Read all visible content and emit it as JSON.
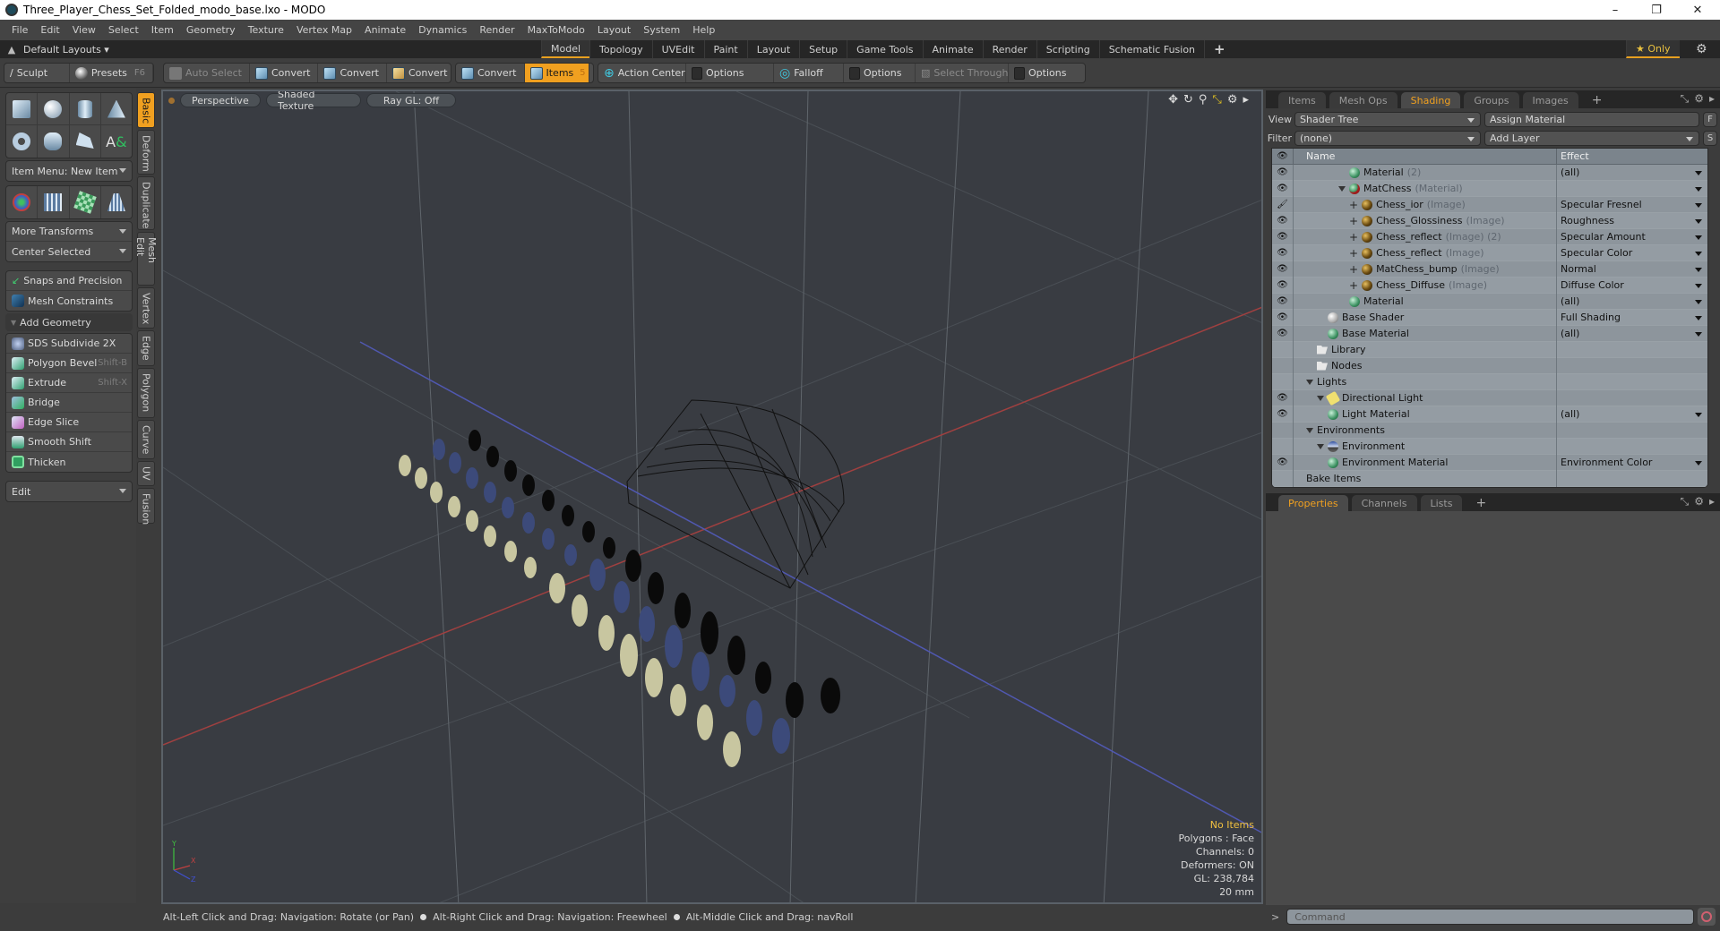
{
  "window": {
    "title": "Three_Player_Chess_Set_Folded_modo_base.lxo - MODO",
    "controls": [
      "minimize-icon",
      "restore-icon",
      "close-icon"
    ]
  },
  "menu": [
    "File",
    "Edit",
    "View",
    "Select",
    "Item",
    "Geometry",
    "Texture",
    "Vertex Map",
    "Animate",
    "Dynamics",
    "Render",
    "MaxToModo",
    "Layout",
    "System",
    "Help"
  ],
  "layoutbar": {
    "layouts_label": "Default Layouts ▾",
    "tabs": [
      "Model",
      "Topology",
      "UVEdit",
      "Paint",
      "Layout",
      "Setup",
      "Game Tools",
      "Animate",
      "Render",
      "Scripting",
      "Schematic Fusion"
    ],
    "active_tab": "Model",
    "add": "+",
    "only_label": "★ Only"
  },
  "toolbar": {
    "sculpt": "Sculpt",
    "presets": "Presets",
    "presets_key": "F6",
    "auto_select": "Auto Select",
    "convert1": "Convert",
    "convert2": "Convert",
    "convert3": "Convert",
    "convert4": "Convert",
    "items": "Items",
    "items_count": "5",
    "action_center": "Action Center",
    "options1": "Options",
    "falloff": "Falloff",
    "options2": "Options",
    "select_through": "Select Through",
    "options3": "Options"
  },
  "leftpanel": {
    "item_menu": "Item Menu: New Item",
    "more_transforms": "More Transforms",
    "center_selected": "Center Selected",
    "snaps": "Snaps and Precision",
    "mesh_constraints": "Mesh Constraints",
    "add_geometry": "Add Geometry",
    "tools": [
      {
        "label": "SDS Subdivide 2X",
        "shortcut": ""
      },
      {
        "label": "Polygon Bevel",
        "shortcut": "Shift-B"
      },
      {
        "label": "Extrude",
        "shortcut": "Shift-X"
      },
      {
        "label": "Bridge",
        "shortcut": ""
      },
      {
        "label": "Edge Slice",
        "shortcut": ""
      },
      {
        "label": "Smooth Shift",
        "shortcut": ""
      },
      {
        "label": "Thicken",
        "shortcut": ""
      }
    ],
    "edit": "Edit",
    "vtabs": [
      "Basic",
      "Deform",
      "Duplicate",
      "Mesh Edit",
      "Vertex",
      "Edge",
      "Polygon",
      "Curve",
      "UV",
      "Fusion"
    ],
    "active_vtab": "Basic"
  },
  "viewport": {
    "view": "Perspective",
    "shading": "Shaded Texture",
    "raygl": "Ray GL: Off",
    "info": {
      "items": "No Items",
      "polygons": "Polygons : Face",
      "channels": "Channels: 0",
      "deformers": "Deformers: ON",
      "gl": "GL: 238,784",
      "unit": "20 mm"
    },
    "axis": {
      "x": "X",
      "y": "Y",
      "z": "Z"
    }
  },
  "statusbar": {
    "hint1": "Alt-Left Click and Drag: Navigation: Rotate (or Pan)",
    "hint2": "Alt-Right Click and Drag: Navigation: Freewheel",
    "hint3": "Alt-Middle Click and Drag: navRoll"
  },
  "shading_panel": {
    "tabs": [
      "Items",
      "Mesh Ops",
      "Shading",
      "Groups",
      "Images"
    ],
    "active_tab": "Shading",
    "view_label": "View",
    "view_value": "Shader Tree",
    "assign_material": "Assign Material",
    "f_btn": "F",
    "filter_label": "Filter",
    "filter_value": "(none)",
    "add_layer": "Add Layer",
    "s_btn": "S",
    "columns": {
      "name": "Name",
      "effect": "Effect"
    },
    "rows": [
      {
        "eye": "eye",
        "indent": 4,
        "toggle": "",
        "icon": "b-green",
        "name": "Material",
        "type": "(2)",
        "effect": "(all)",
        "dd": true
      },
      {
        "eye": "eye",
        "indent": 3,
        "toggle": "tri",
        "icon": "b-red",
        "name": "MatChess",
        "type": "(Material)",
        "effect": "",
        "dd": true
      },
      {
        "eye": "brush",
        "indent": 4,
        "toggle": "plus",
        "icon": "b-img",
        "name": "Chess_ior",
        "type": "(Image)",
        "effect": "Specular Fresnel",
        "dd": true
      },
      {
        "eye": "eye",
        "indent": 4,
        "toggle": "plus",
        "icon": "b-img",
        "name": "Chess_Glossiness",
        "type": "(Image)",
        "effect": "Roughness",
        "dd": true
      },
      {
        "eye": "eye",
        "indent": 4,
        "toggle": "plus",
        "icon": "b-img",
        "name": "Chess_reflect",
        "type": "(Image) (2)",
        "effect": "Specular Amount",
        "dd": true
      },
      {
        "eye": "eye",
        "indent": 4,
        "toggle": "plus",
        "icon": "b-img",
        "name": "Chess_reflect",
        "type": "(Image)",
        "effect": "Specular Color",
        "dd": true
      },
      {
        "eye": "eye",
        "indent": 4,
        "toggle": "plus",
        "icon": "b-img",
        "name": "MatChess_bump",
        "type": "(Image)",
        "effect": "Normal",
        "dd": true
      },
      {
        "eye": "eye",
        "indent": 4,
        "toggle": "plus",
        "icon": "b-img",
        "name": "Chess_Diffuse",
        "type": "(Image)",
        "effect": "Diffuse Color",
        "dd": true
      },
      {
        "eye": "eye",
        "indent": 4,
        "toggle": "",
        "icon": "b-green",
        "name": "Material",
        "type": "",
        "effect": "(all)",
        "dd": true
      },
      {
        "eye": "eye",
        "indent": 2,
        "toggle": "",
        "icon": "b-white",
        "name": "Base Shader",
        "type": "",
        "effect": "Full Shading",
        "dd": true
      },
      {
        "eye": "eye",
        "indent": 2,
        "toggle": "",
        "icon": "b-green",
        "name": "Base Material",
        "type": "",
        "effect": "(all)",
        "dd": true
      },
      {
        "eye": "",
        "indent": 1,
        "toggle": "",
        "icon": "folder",
        "name": "Library",
        "type": "",
        "effect": "",
        "dd": false
      },
      {
        "eye": "",
        "indent": 1,
        "toggle": "",
        "icon": "folder",
        "name": "Nodes",
        "type": "",
        "effect": "",
        "dd": false
      },
      {
        "eye": "",
        "indent": 0,
        "toggle": "tri",
        "icon": "",
        "name": "Lights",
        "type": "",
        "effect": "",
        "dd": false
      },
      {
        "eye": "eye",
        "indent": 1,
        "toggle": "tri",
        "icon": "b-light",
        "name": "Directional Light",
        "type": "",
        "effect": "",
        "dd": false
      },
      {
        "eye": "eye",
        "indent": 2,
        "toggle": "",
        "icon": "b-green",
        "name": "Light Material",
        "type": "",
        "effect": "(all)",
        "dd": true
      },
      {
        "eye": "",
        "indent": 0,
        "toggle": "tri",
        "icon": "",
        "name": "Environments",
        "type": "",
        "effect": "",
        "dd": false
      },
      {
        "eye": "",
        "indent": 1,
        "toggle": "tri",
        "icon": "b-env",
        "name": "Environment",
        "type": "",
        "effect": "",
        "dd": false
      },
      {
        "eye": "eye",
        "indent": 2,
        "toggle": "",
        "icon": "b-green",
        "name": "Environment Material",
        "type": "",
        "effect": "Environment Color",
        "dd": true
      },
      {
        "eye": "",
        "indent": 0,
        "toggle": "",
        "icon": "",
        "name": "Bake Items",
        "type": "",
        "effect": "",
        "dd": false
      }
    ]
  },
  "properties_panel": {
    "tabs": [
      "Properties",
      "Channels",
      "Lists"
    ],
    "active_tab": "Properties"
  },
  "command": {
    "prompt": ">",
    "placeholder": "Command"
  },
  "colors": {
    "accent": "#f0a020",
    "info_highlight": "#f0c040",
    "x_axis": "#c0504a",
    "z_axis": "#5060c0"
  }
}
